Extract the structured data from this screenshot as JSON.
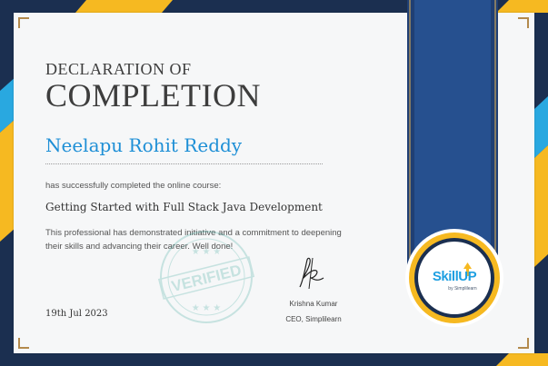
{
  "certificate": {
    "heading_line1": "DECLARATION OF",
    "heading_line2": "COMPLETION",
    "recipient_name": "Neelapu Rohit Reddy",
    "intro_text": "has successfully completed the online course:",
    "course_title": "Getting Started with Full Stack Java Development",
    "description": "This professional has demonstrated initiative and a commitment to deepening their skills and advancing their career. Well done!",
    "date": "19th Jul 2023",
    "signer_name": "Krishna Kumar",
    "signer_title": "CEO, Simplilearn",
    "stamp_text": "VERIFIED"
  },
  "badge": {
    "brand": "SkillUP",
    "sub": "by Simplilearn"
  },
  "colors": {
    "navy": "#1b2f50",
    "gold": "#f6b921",
    "sky": "#29a8e0",
    "name_blue": "#1e8fd6",
    "card": "#f6f7f8"
  },
  "icons": [
    "signature-icon",
    "verified-stamp-icon",
    "badge-arrow-icon"
  ]
}
